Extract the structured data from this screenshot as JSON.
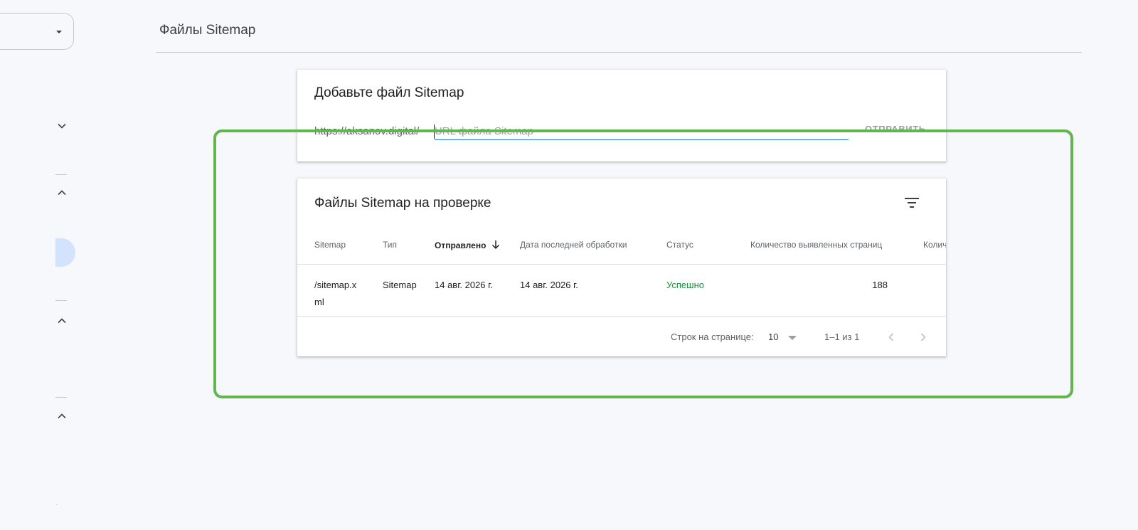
{
  "header": {
    "title": "Файлы Sitemap"
  },
  "add_card": {
    "title": "Добавьте файл Sitemap",
    "url_prefix": "https://aksanov.digital/",
    "input_placeholder": "URL файла Sitemap",
    "input_value": "",
    "submit_label": "ОТПРАВИТЬ"
  },
  "list_card": {
    "title": "Файлы Sitemap на проверке",
    "columns": [
      "Sitemap",
      "Тип",
      "Отправлено",
      "Дата последней обработки",
      "Статус",
      "Количество выявленных страниц",
      "Колич"
    ],
    "sorted_column": "Отправлено",
    "rows": [
      {
        "sitemap_line1": "/sitemap.x",
        "sitemap_line2": "ml",
        "type": "Sitemap",
        "submitted": "14 авг. 2026 г.",
        "last_read": "14 авг. 2026 г.",
        "status": "Успешно",
        "discovered_pages": "188"
      }
    ],
    "pager": {
      "rows_label": "Строк на странице:",
      "rows_value": "10",
      "range": "1–1 из 1"
    }
  },
  "icons": {
    "sort": "arrow-down-icon",
    "filter": "filter-icon",
    "prev": "chevron-left-icon",
    "next": "chevron-right-icon"
  },
  "colors": {
    "accent": "#1a73e8",
    "status_success": "#1e8e3e",
    "highlight": "#62b64e",
    "background": "#f6f8fc"
  }
}
